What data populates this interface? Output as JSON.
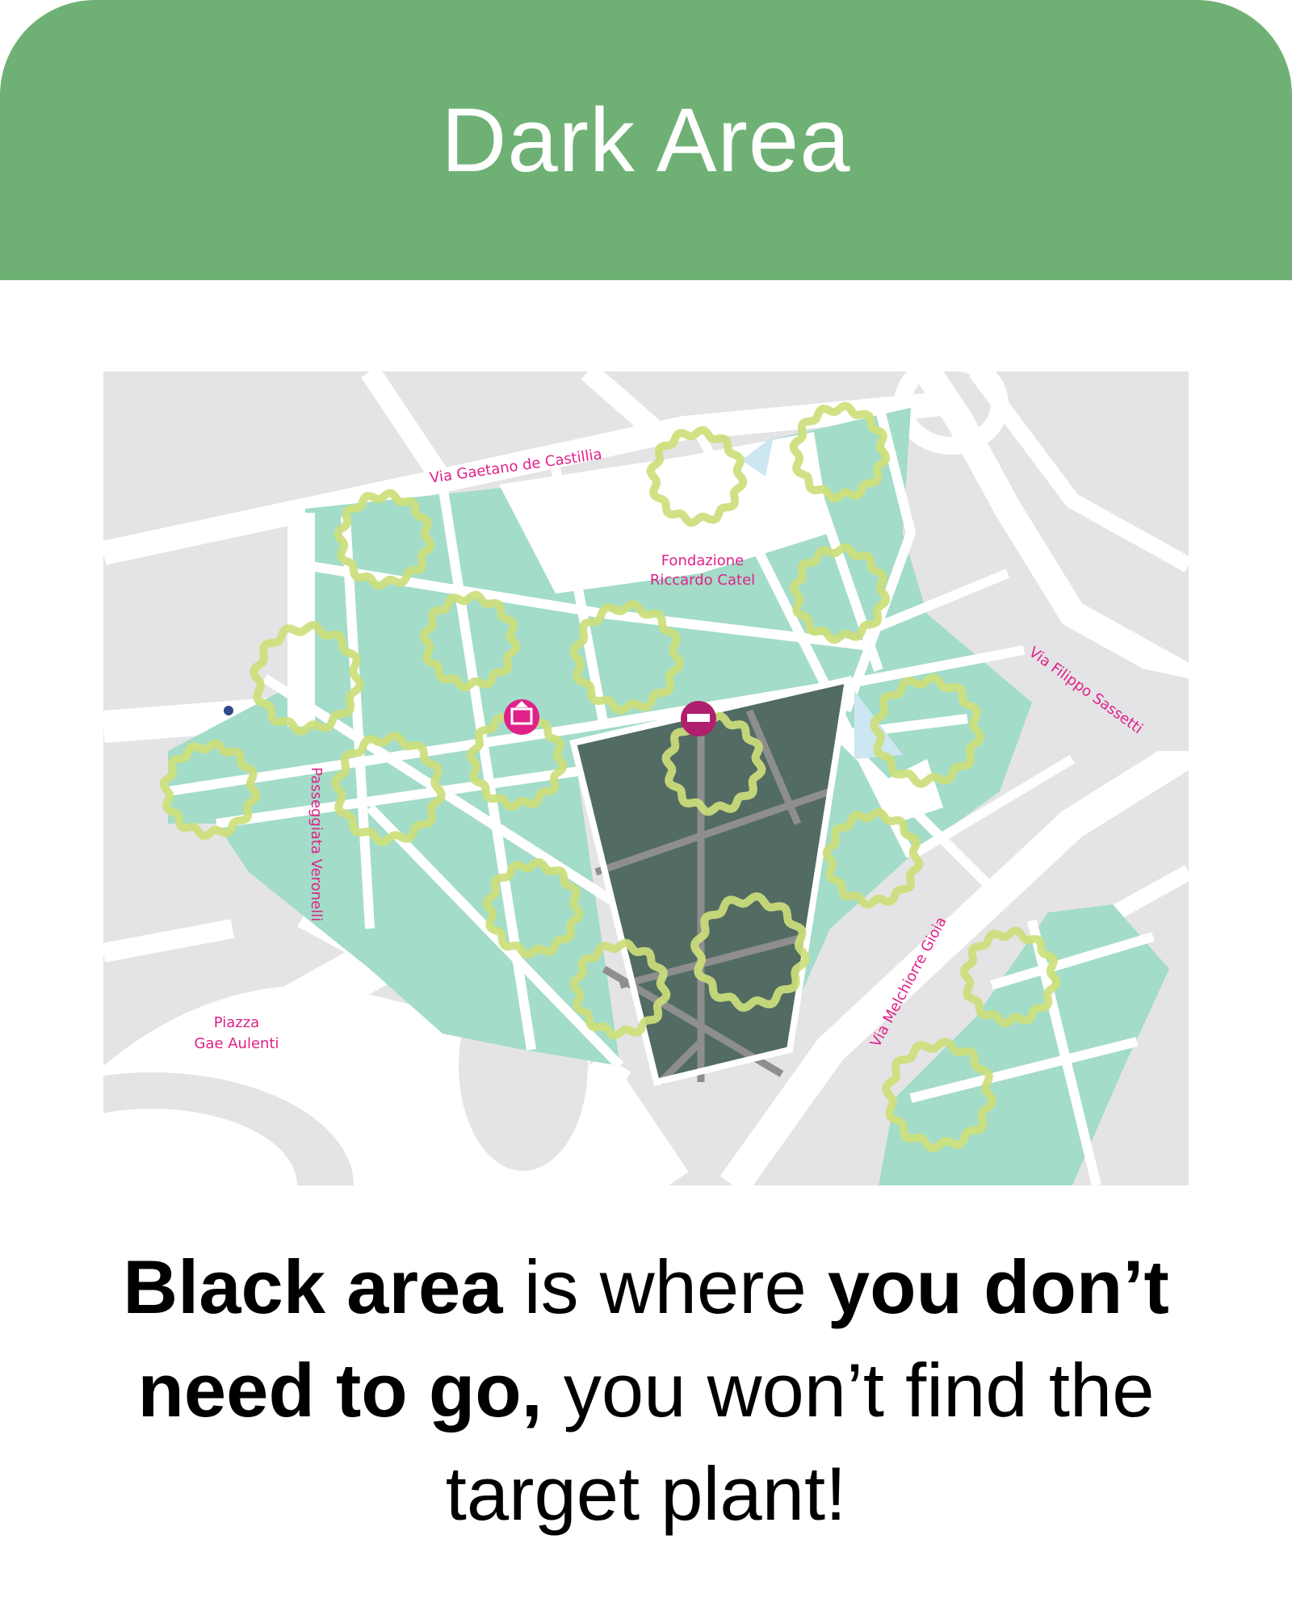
{
  "header": {
    "title": "Dark Area"
  },
  "colors": {
    "header_bg": "#6fb175",
    "park_green": "#a3dcc9",
    "dark_area": "#526b63",
    "plant_marker": "#cddf7b",
    "street_label": "#e0218a",
    "water": "#cce6f2",
    "block_gray": "#e4e4e6"
  },
  "map": {
    "street_labels": {
      "castillia": "Via Gaetano de Castillia",
      "sassetti": "Via Filippo Sassetti",
      "veronelli": "Passeggiata Veronelli",
      "gioia": "Via Melchiorre Gioia"
    },
    "place_labels": {
      "fondazione_line1": "Fondazione",
      "fondazione_line2": "Riccardo Catel",
      "piazza_line1": "Piazza",
      "piazza_line2": "Gae Aulenti"
    },
    "poi_icons": [
      "museum-icon",
      "restroom-icon"
    ],
    "plant_marker_count": 17
  },
  "caption": {
    "bold1": "Black area",
    "normal1": " is where ",
    "bold2": "you don’t need to go,",
    "normal2": " you won’t find the target plant!"
  }
}
